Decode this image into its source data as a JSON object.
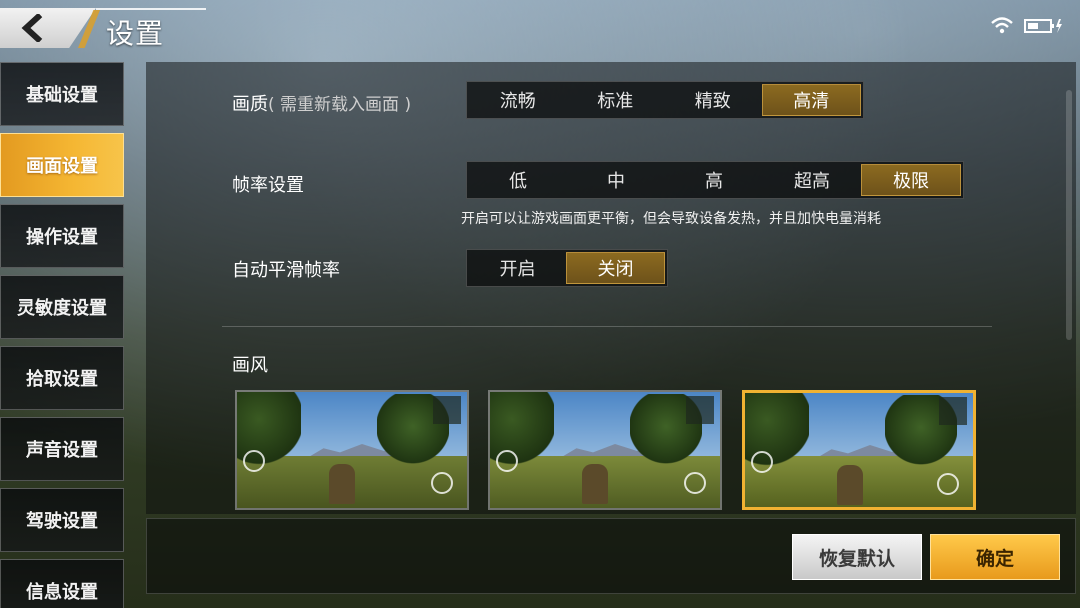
{
  "header": {
    "title": "设置",
    "back_icon": "back-arrow-icon",
    "wifi_icon": "wifi-icon",
    "battery_icon": "battery-charging-icon"
  },
  "sidebar": {
    "items": [
      {
        "label": "基础设置"
      },
      {
        "label": "画面设置",
        "active": true
      },
      {
        "label": "操作设置"
      },
      {
        "label": "灵敏度设置"
      },
      {
        "label": "拾取设置"
      },
      {
        "label": "声音设置"
      },
      {
        "label": "驾驶设置"
      },
      {
        "label": "信息设置"
      }
    ]
  },
  "graphics": {
    "quality": {
      "label": "画质",
      "note": "( 需重新载入画面 )",
      "options": [
        "流畅",
        "标准",
        "精致",
        "高清"
      ],
      "selected": "高清"
    },
    "framerate": {
      "label": "帧率设置",
      "options": [
        "低",
        "中",
        "高",
        "超高",
        "极限"
      ],
      "selected": "极限",
      "hint": "开启可以让游戏画面更平衡，但会导致设备发热，并且加快电量消耗"
    },
    "smooth_framerate": {
      "label": "自动平滑帧率",
      "options": [
        "开启",
        "关闭"
      ],
      "selected": "关闭"
    },
    "style": {
      "label": "画风",
      "thumbnails": [
        "style-preview-1",
        "style-preview-2",
        "style-preview-3"
      ],
      "selected_index": 2
    }
  },
  "footer": {
    "reset_label": "恢复默认",
    "confirm_label": "确定"
  },
  "colors": {
    "accent": "#f0b232",
    "selected_option": "#7a5c1c"
  }
}
